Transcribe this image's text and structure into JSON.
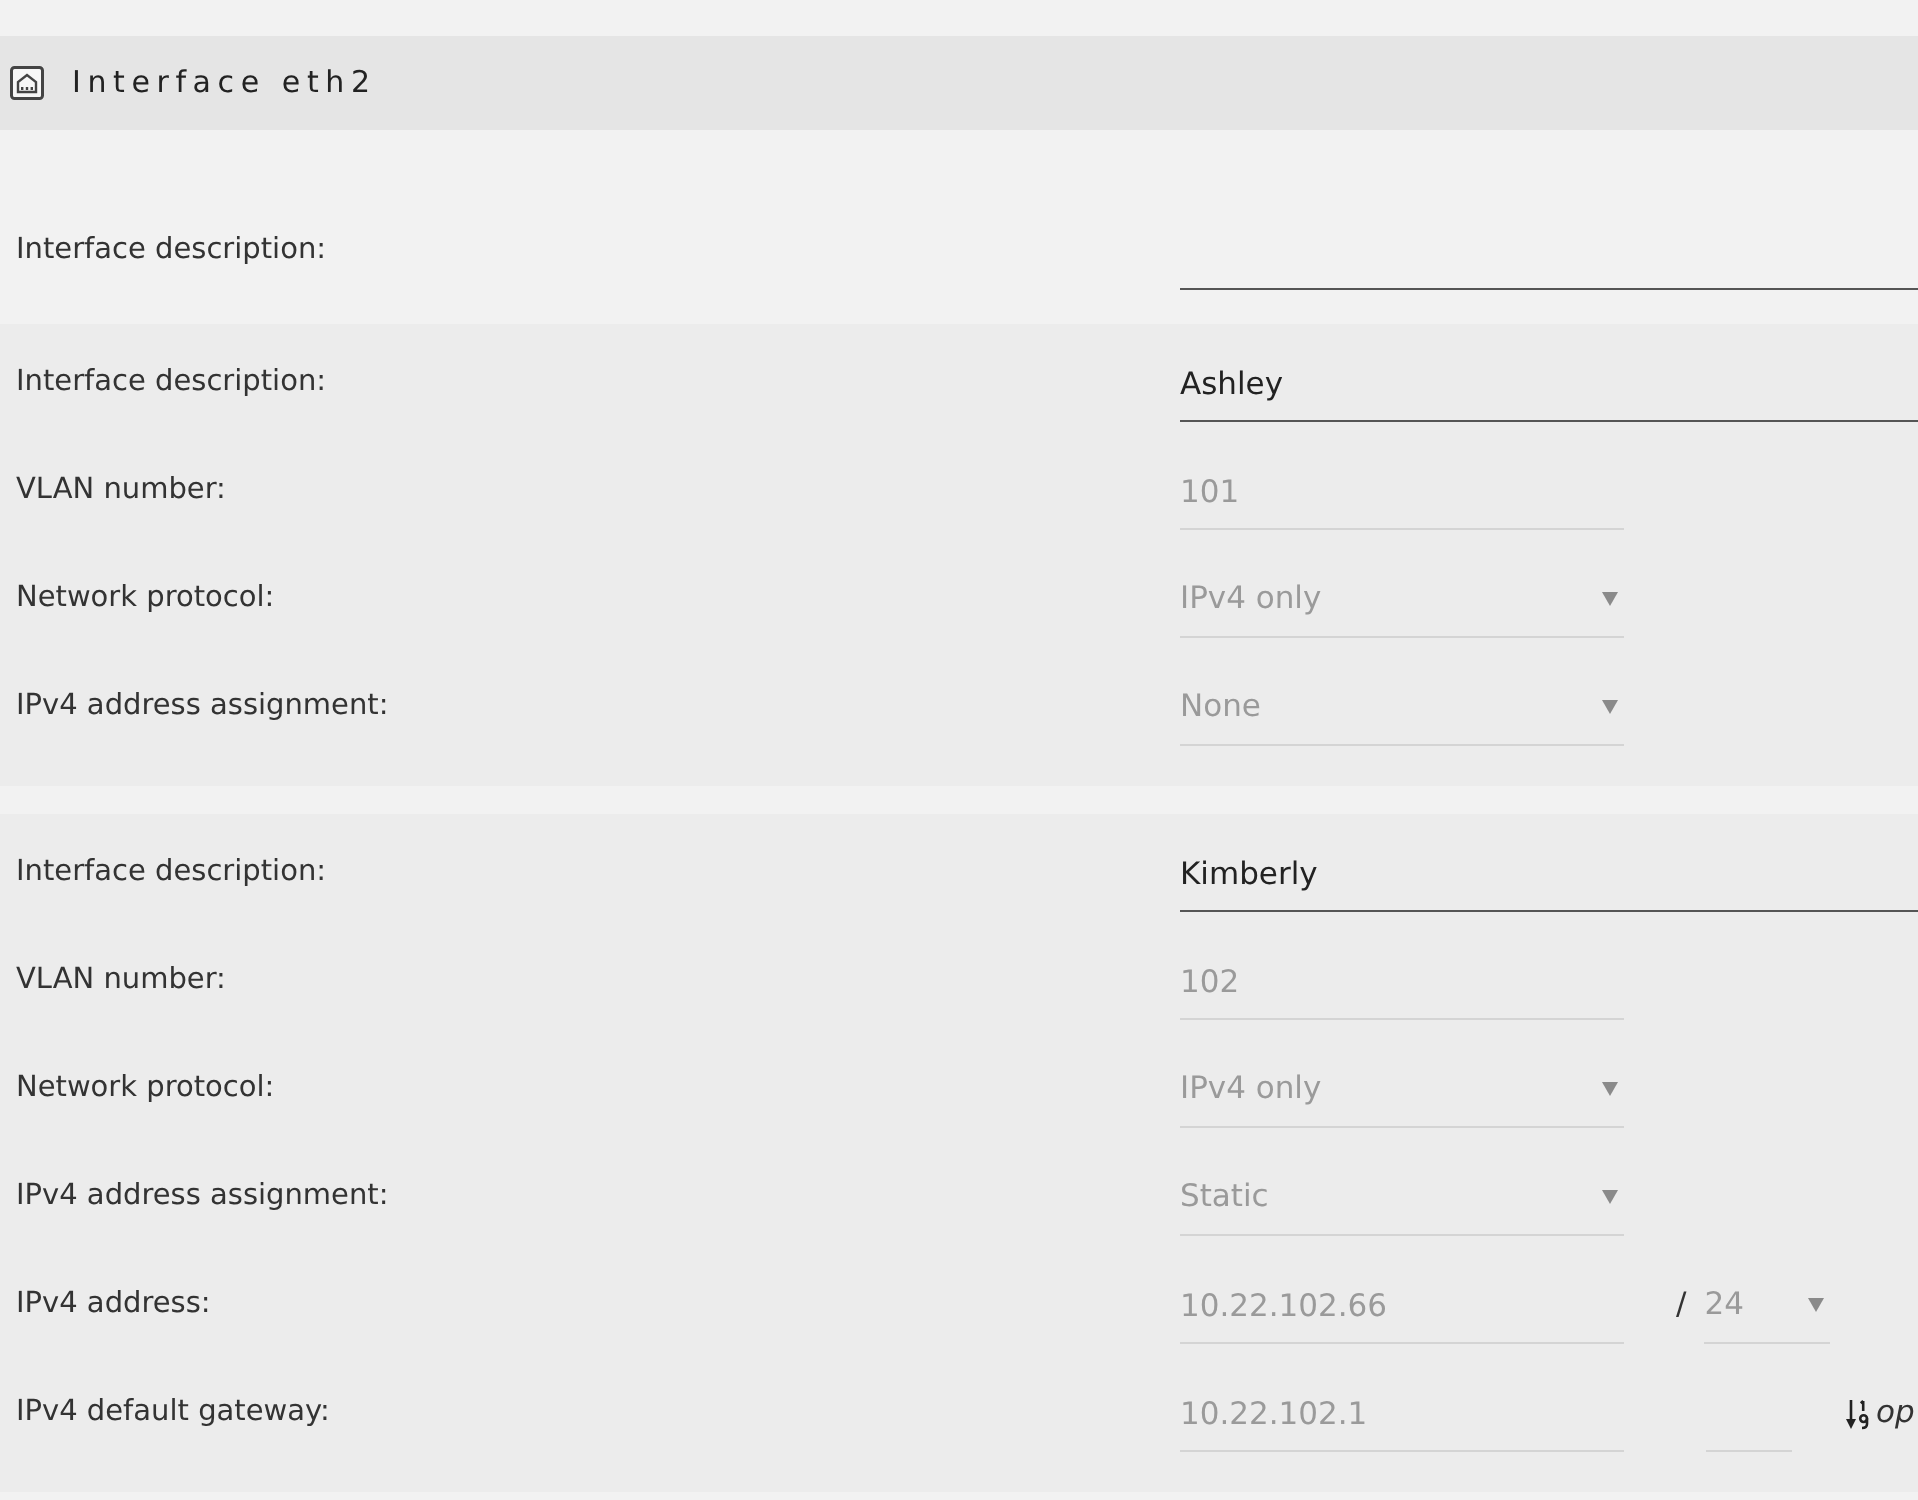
{
  "header": {
    "title": "Interface eth2"
  },
  "sections": [
    {
      "kind": "interface",
      "rows": [
        {
          "kind": "description",
          "label": "Interface description:",
          "disabled": false
        }
      ]
    },
    {
      "kind": "vlan",
      "rows": [
        {
          "kind": "description",
          "label": "Interface description:",
          "value": "Ashley",
          "disabled": false
        },
        {
          "kind": "number",
          "label": "VLAN number:",
          "value": "101",
          "disabled": true
        },
        {
          "kind": "select",
          "label": "Network protocol:",
          "value": "IPv4 only",
          "disabled": true
        },
        {
          "kind": "select",
          "label": "IPv4 address assignment:",
          "value": "None",
          "disabled": true
        }
      ]
    },
    {
      "kind": "vlan",
      "rows": [
        {
          "kind": "description",
          "label": "Interface description:",
          "value": "Kimberly",
          "disabled": false
        },
        {
          "kind": "number",
          "label": "VLAN number:",
          "value": "102",
          "disabled": true
        },
        {
          "kind": "select",
          "label": "Network protocol:",
          "value": "IPv4 only",
          "disabled": true
        },
        {
          "kind": "select",
          "label": "IPv4 address assignment:",
          "value": "Static",
          "disabled": true
        },
        {
          "kind": "address",
          "label": "IPv4 address:",
          "value": "10.22.102.66",
          "disabled": true,
          "separator": "/",
          "prefix": "24"
        },
        {
          "kind": "gateway",
          "label": "IPv4 default gateway:",
          "value": "10.22.102.1",
          "disabled": true,
          "note": "op"
        }
      ]
    }
  ]
}
